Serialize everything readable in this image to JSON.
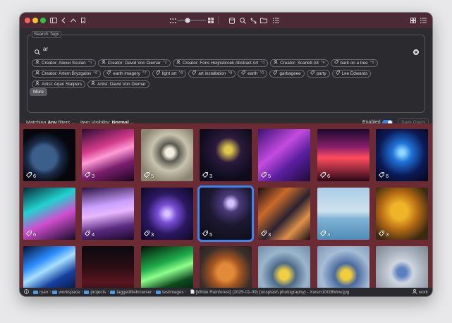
{
  "window": {
    "traffic_colors": [
      "#fe5f57",
      "#febc2e",
      "#28c840"
    ]
  },
  "toolbar": {
    "icons": [
      "sidebar-icon",
      "back-icon",
      "up-icon",
      "bookmark-icon",
      "small-grid-icon",
      "large-grid-icon",
      "database-icon",
      "search-icon",
      "branch-icon",
      "folder-icon",
      "sort-icon",
      "gallery-icon",
      "list-icon"
    ]
  },
  "search": {
    "panel_title": "Search Tags",
    "query": "ar"
  },
  "chips": [
    {
      "icon": "person",
      "label": "Creator: Alexei Scutari",
      "count": "^1"
    },
    {
      "icon": "person",
      "label": "Creator: David Von Diemar",
      "count": "^2"
    },
    {
      "icon": "person",
      "label": "Creator: Fons Heijnsbroek Abstract Art",
      "count": "^3"
    },
    {
      "icon": "person",
      "label": "Creator: Scarlett Alt",
      "count": "^4"
    },
    {
      "icon": "tag",
      "label": "bark on a tree",
      "count": "^5"
    },
    {
      "icon": "person",
      "label": "Creator: Artem Bryzgalov",
      "count": "^6"
    },
    {
      "icon": "tag",
      "label": "earth imagery",
      "count": "^7"
    },
    {
      "icon": "tag",
      "label": "light art",
      "count": "^8"
    },
    {
      "icon": "tag",
      "label": "art installation",
      "count": "^9"
    },
    {
      "icon": "tag",
      "label": "earth",
      "count": "^0"
    },
    {
      "icon": "tag",
      "label": "garbageee",
      "count": ""
    },
    {
      "icon": "tag",
      "label": "party",
      "count": ""
    },
    {
      "icon": "tag",
      "label": "Lee Edwards",
      "count": ""
    },
    {
      "icon": "person",
      "label": "Artist: Arjan Stalpers",
      "count": ""
    },
    {
      "icon": "person",
      "label": "Artist: David Von Diemar",
      "count": ""
    }
  ],
  "more_label": "More",
  "filters": {
    "matching_prefix": "Matching",
    "matching_value": "Any",
    "matching_suffix": "filters",
    "visibility_prefix": "Item Visibility:",
    "visibility_value": "Normal",
    "enabled_label": "Enabled",
    "save_label": "Save Query"
  },
  "tiles": [
    {
      "count": "6",
      "theme": "earth"
    },
    {
      "count": "3",
      "theme": "pink-lasers"
    },
    {
      "count": "5",
      "theme": "bird-branch"
    },
    {
      "count": "3",
      "theme": "neon-five"
    },
    {
      "count": "5",
      "theme": "purple-disco"
    },
    {
      "count": "6",
      "theme": "concert-red"
    },
    {
      "count": "6",
      "theme": "blue-lasers"
    },
    {
      "count": "6",
      "theme": "green-laser"
    },
    {
      "count": "4",
      "theme": "pink-stage"
    },
    {
      "count": "3",
      "theme": "purple-sculpture"
    },
    {
      "count": "5",
      "theme": "dark-ring"
    },
    {
      "count": "3",
      "theme": "night-city"
    },
    {
      "count": "3",
      "theme": "sea-paddle"
    },
    {
      "count": "3",
      "theme": "autumn-leaves"
    },
    {
      "count": "",
      "theme": "blue-lasers-2"
    },
    {
      "count": "",
      "theme": "dark-red"
    },
    {
      "count": "",
      "theme": "green-rays"
    },
    {
      "count": "",
      "theme": "dog"
    },
    {
      "count": "",
      "theme": "bird-2"
    },
    {
      "count": "",
      "theme": "bird-3"
    },
    {
      "count": "",
      "theme": "bird-4"
    }
  ],
  "status": {
    "path": [
      "ryan",
      "workspace",
      "projects",
      "taggedfilebrowser",
      "testimages"
    ],
    "file": "[White Rainforest] (2025-01-09) {unsplash,photography} - Xwsm10GBMvw.jpg",
    "user": "work"
  }
}
